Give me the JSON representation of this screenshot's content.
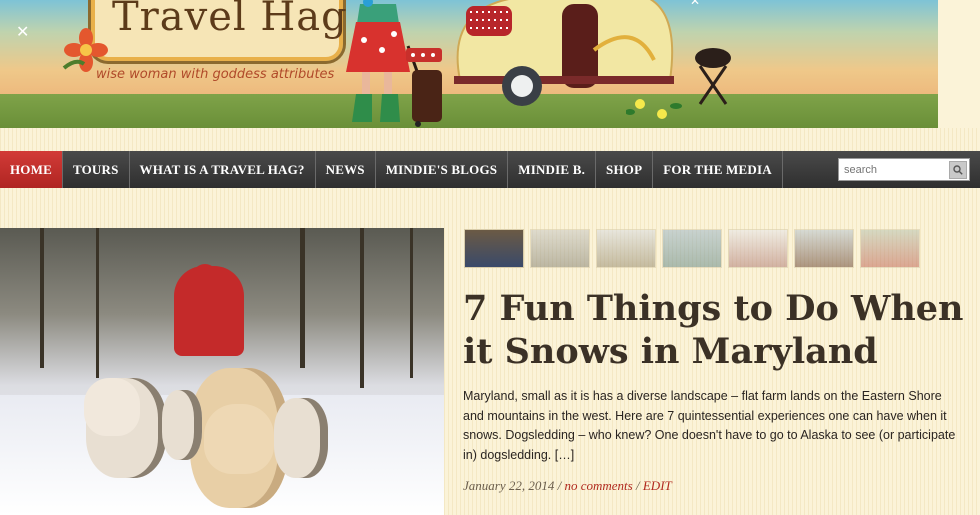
{
  "site": {
    "logo_title": "Travel Hag",
    "tagline": "wise woman with goddess attributes"
  },
  "nav": {
    "items": [
      {
        "label": "HOME",
        "active": true
      },
      {
        "label": "TOURS"
      },
      {
        "label": "WHAT IS A TRAVEL HAG?"
      },
      {
        "label": "NEWS"
      },
      {
        "label": "MINDIE'S BLOGS"
      },
      {
        "label": "MINDIE B."
      },
      {
        "label": "SHOP"
      },
      {
        "label": "FOR THE MEDIA"
      }
    ],
    "search_placeholder": "search"
  },
  "thumbnails": [
    {
      "icon": "thumbnail-person-portrait"
    },
    {
      "icon": "thumbnail-rock-landscape"
    },
    {
      "icon": "thumbnail-monument"
    },
    {
      "icon": "thumbnail-harbor"
    },
    {
      "icon": "thumbnail-snowy-scene"
    },
    {
      "icon": "thumbnail-historic-building"
    },
    {
      "icon": "thumbnail-group-photo"
    }
  ],
  "post": {
    "title": "7 Fun Things to Do When it Snows in Maryland",
    "excerpt": "Maryland, small as it is has a diverse landscape – flat farm lands on the Eastern Shore and mountains in the west. Here are 7 quintessential experiences one can have when it snows. Dogsledding – who knew? One doesn't have to go to Alaska to see (or participate in) dogsledding.  […]",
    "date": "January 22, 2014",
    "separator": "/",
    "comments": "no comments",
    "edit": "EDIT"
  },
  "colors": {
    "nav_active": "#c4302c",
    "nav_bg": "#3a3a3a",
    "link": "#b12a1f",
    "title": "#3b3126",
    "background": "#fbf3d8"
  }
}
